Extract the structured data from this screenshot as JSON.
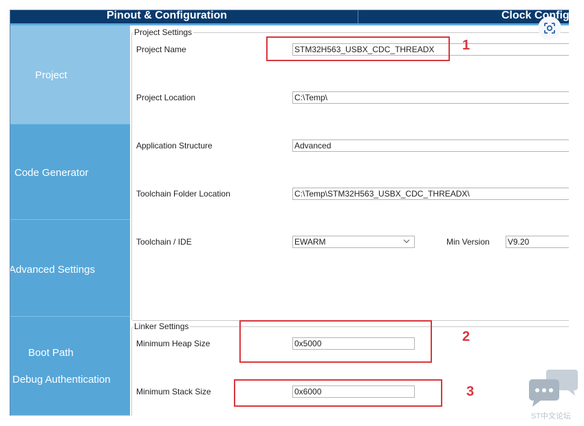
{
  "topbar": {
    "tab_pinout": "Pinout & Configuration",
    "tab_clock": "Clock Config"
  },
  "sidebar": {
    "items": [
      {
        "label": "Project"
      },
      {
        "label": "Code Generator"
      },
      {
        "label": "Advanced Settings"
      },
      {
        "label": "Boot Path"
      },
      {
        "label": "Debug Authentication"
      }
    ]
  },
  "project_settings": {
    "legend": "Project Settings",
    "project_name_label": "Project Name",
    "project_name_value": "STM32H563_USBX_CDC_THREADX",
    "project_location_label": "Project Location",
    "project_location_value": "C:\\Temp\\",
    "app_structure_label": "Application Structure",
    "app_structure_value": "Advanced",
    "toolchain_folder_label": "Toolchain Folder Location",
    "toolchain_folder_value": "C:\\Temp\\STM32H563_USBX_CDC_THREADX\\",
    "toolchain_ide_label": "Toolchain / IDE",
    "toolchain_ide_value": "EWARM",
    "min_version_label": "Min Version",
    "min_version_value": "V9.20"
  },
  "linker_settings": {
    "legend": "Linker Settings",
    "min_heap_label": "Minimum Heap Size",
    "min_heap_value": "0x5000",
    "min_stack_label": "Minimum Stack Size",
    "min_stack_value": "0x6000"
  },
  "annotations": {
    "n1": "1",
    "n2": "2",
    "n3": "3",
    "color": "#d9363e"
  },
  "watermark": {
    "text": "ST中文论坛"
  },
  "colors": {
    "topbar": "#0a3a6c",
    "sidebar": "#56a6d8",
    "sidebar_active": "#8ec4e6"
  }
}
